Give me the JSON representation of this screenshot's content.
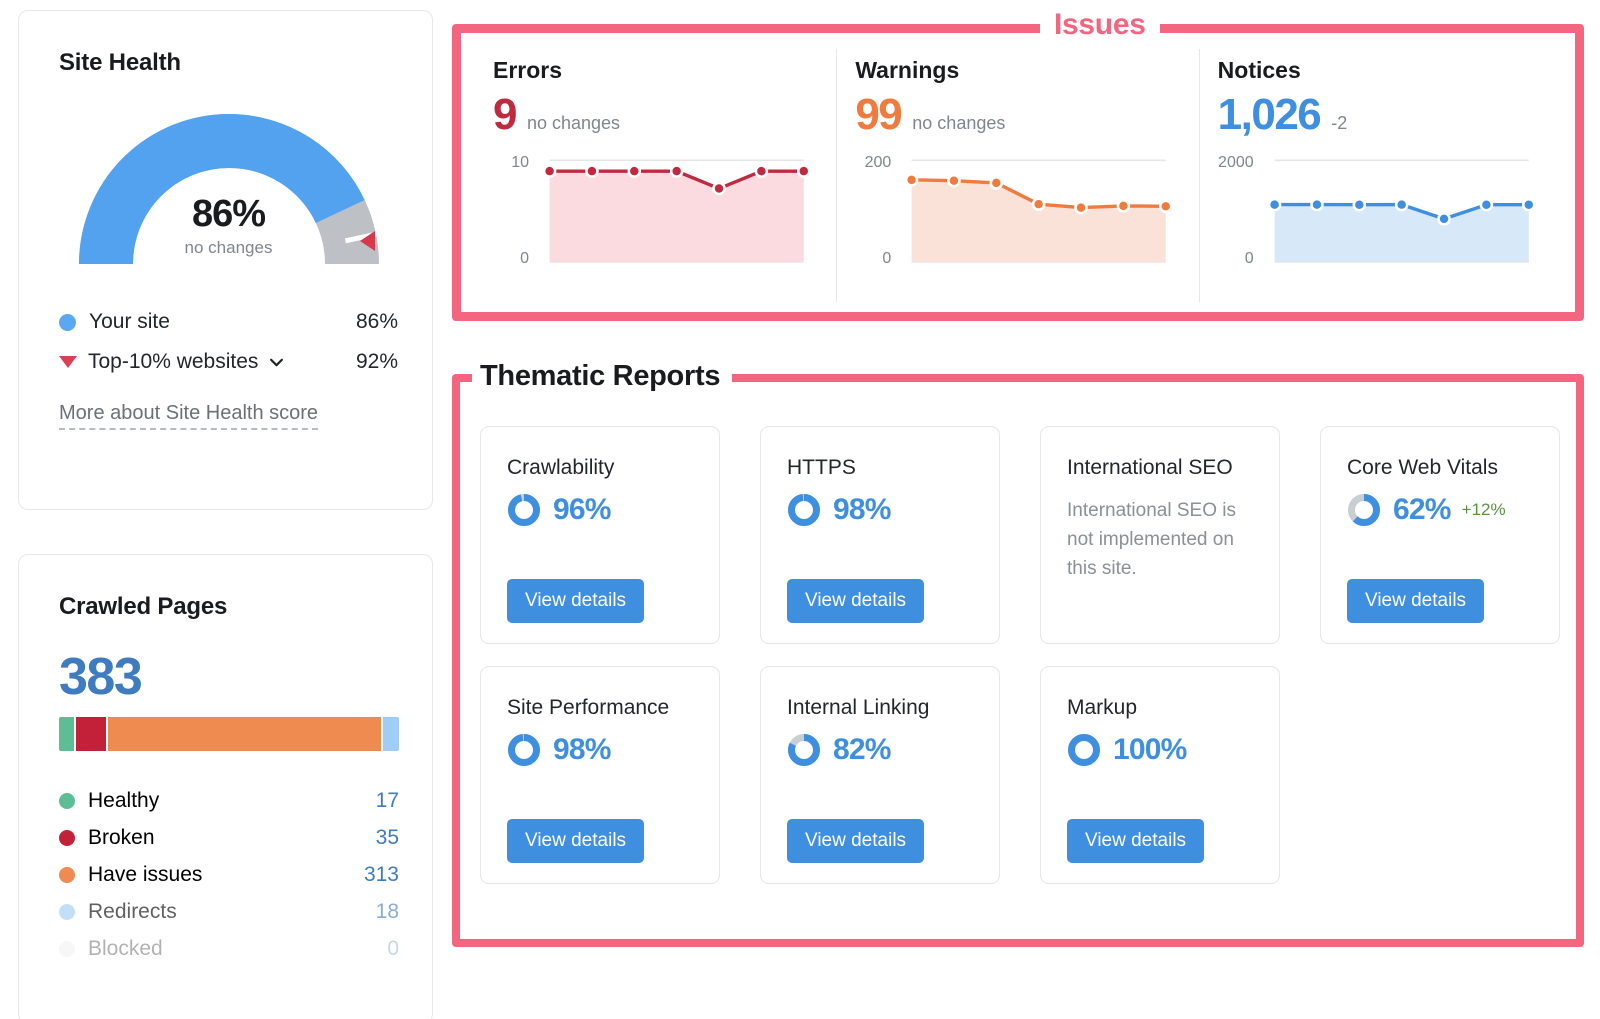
{
  "site_health": {
    "title": "Site Health",
    "gauge": {
      "value": "86%",
      "subtitle": "no changes",
      "score": 86,
      "benchmark": 92
    },
    "legend": [
      {
        "label": "Your site",
        "value": "86%",
        "marker": "dot",
        "color": "#5aa9f0"
      },
      {
        "label": "Top-10% websites",
        "value": "92%",
        "marker": "triangle",
        "color": "#dd4055",
        "has_dropdown": true
      }
    ],
    "more_link": "More about Site Health score"
  },
  "crawled_pages": {
    "title": "Crawled Pages",
    "total": "383",
    "legend": [
      {
        "label": "Healthy",
        "value": "17",
        "color": "#5dbd93",
        "count": 17
      },
      {
        "label": "Broken",
        "value": "35",
        "color": "#c32139",
        "count": 35
      },
      {
        "label": "Have issues",
        "value": "313",
        "color": "#ef8b50",
        "count": 313
      },
      {
        "label": "Redirects",
        "value": "18",
        "color": "#9fcdf5",
        "count": 18
      },
      {
        "label": "Blocked",
        "value": "0",
        "color": "#e3e5e7",
        "count": 0
      }
    ]
  },
  "issues": {
    "panel_label": "Issues",
    "accent_color": "#f4657f",
    "columns": [
      {
        "title": "Errors",
        "value": "9",
        "delta": "no changes",
        "color": "#c02a41",
        "fill": "#fbdbdf",
        "axis_top": "10",
        "axis_bottom": "0"
      },
      {
        "title": "Warnings",
        "value": "99",
        "delta": "no changes",
        "color": "#ef7b3f",
        "fill": "#fbe2d8",
        "axis_top": "200",
        "axis_bottom": "0"
      },
      {
        "title": "Notices",
        "value": "1,026",
        "delta": "-2",
        "color": "#3f8fe0",
        "fill": "#d7e9f8",
        "axis_top": "2000",
        "axis_bottom": "0"
      }
    ]
  },
  "thematic_reports": {
    "panel_label": "Thematic Reports",
    "view_details_label": "View details",
    "cards": [
      {
        "name": "Crawlability",
        "pct": "96%",
        "score": 96,
        "change": "",
        "desc": ""
      },
      {
        "name": "HTTPS",
        "pct": "98%",
        "score": 98,
        "change": "",
        "desc": ""
      },
      {
        "name": "International SEO",
        "pct": "",
        "score": null,
        "change": "",
        "desc": "International SEO is not implemented on this site."
      },
      {
        "name": "Core Web Vitals",
        "pct": "62%",
        "score": 62,
        "change": "+12%",
        "desc": ""
      },
      {
        "name": "Site Performance",
        "pct": "98%",
        "score": 98,
        "change": "",
        "desc": ""
      },
      {
        "name": "Internal Linking",
        "pct": "82%",
        "score": 82,
        "change": "",
        "desc": ""
      },
      {
        "name": "Markup",
        "pct": "100%",
        "score": 100,
        "change": "",
        "desc": ""
      }
    ]
  },
  "chart_data": [
    {
      "type": "line",
      "title": "Errors",
      "ylabel": "",
      "xlabel": "",
      "ylim": [
        0,
        10
      ],
      "grid": true,
      "series": [
        {
          "name": "Errors",
          "values": [
            9,
            9,
            9,
            9,
            7,
            9,
            9
          ]
        }
      ],
      "x": [
        1,
        2,
        3,
        4,
        5,
        6,
        7
      ],
      "color": "#c02a41",
      "fill": "#fbdbdf",
      "axis_ticks": [
        "10",
        "0"
      ]
    },
    {
      "type": "line",
      "title": "Warnings",
      "ylabel": "",
      "xlabel": "",
      "ylim": [
        0,
        200
      ],
      "grid": true,
      "series": [
        {
          "name": "Warnings",
          "values": [
            160,
            158,
            153,
            104,
            96,
            100,
            99
          ]
        }
      ],
      "x": [
        1,
        2,
        3,
        4,
        5,
        6,
        7
      ],
      "color": "#ef7b3f",
      "fill": "#fbe2d8",
      "axis_ticks": [
        "200",
        "0"
      ]
    },
    {
      "type": "line",
      "title": "Notices",
      "ylabel": "",
      "xlabel": "",
      "ylim": [
        0,
        2000
      ],
      "grid": true,
      "series": [
        {
          "name": "Notices",
          "values": [
            1030,
            1030,
            1028,
            1030,
            700,
            1028,
            1026
          ]
        }
      ],
      "x": [
        1,
        2,
        3,
        4,
        5,
        6,
        7
      ],
      "color": "#3f8fe0",
      "fill": "#d7e9f8",
      "axis_ticks": [
        "2000",
        "0"
      ]
    },
    {
      "type": "pie",
      "title": "Site Health gauge",
      "labels": [
        "Your site",
        "Remaining"
      ],
      "values": [
        86,
        14
      ],
      "annotation": "Top-10% websites benchmark at 92%"
    },
    {
      "type": "bar",
      "title": "Crawled Pages breakdown",
      "categories": [
        "Healthy",
        "Broken",
        "Have issues",
        "Redirects",
        "Blocked"
      ],
      "values": [
        17,
        35,
        313,
        18,
        0
      ],
      "total": 383,
      "stacked": true
    }
  ]
}
